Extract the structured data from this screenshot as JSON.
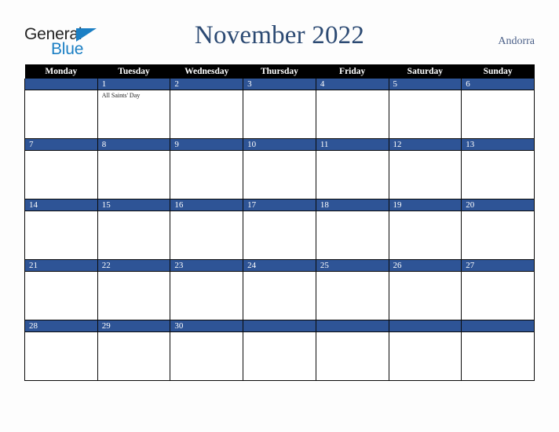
{
  "brand": {
    "line1": "General",
    "line2": "Blue",
    "triangle_color": "#1b7fc4",
    "text_color": "#242424"
  },
  "header": {
    "title": "November 2022",
    "title_color": "#2c4a73",
    "country": "Andorra",
    "country_color": "#4a5f87"
  },
  "calendar": {
    "weekday_headers": [
      "Monday",
      "Tuesday",
      "Wednesday",
      "Thursday",
      "Friday",
      "Saturday",
      "Sunday"
    ],
    "header_bg": "#000000",
    "header_text": "#ffffff",
    "daybar_bg": "#2e5496",
    "daybar_text": "#ffffff",
    "cell_bg": "#ffffff",
    "grid_line": "#0a0a0a",
    "weeks": [
      [
        {
          "day": "",
          "events": []
        },
        {
          "day": "1",
          "events": [
            "All Saints' Day"
          ]
        },
        {
          "day": "2",
          "events": []
        },
        {
          "day": "3",
          "events": []
        },
        {
          "day": "4",
          "events": []
        },
        {
          "day": "5",
          "events": []
        },
        {
          "day": "6",
          "events": []
        }
      ],
      [
        {
          "day": "7",
          "events": []
        },
        {
          "day": "8",
          "events": []
        },
        {
          "day": "9",
          "events": []
        },
        {
          "day": "10",
          "events": []
        },
        {
          "day": "11",
          "events": []
        },
        {
          "day": "12",
          "events": []
        },
        {
          "day": "13",
          "events": []
        }
      ],
      [
        {
          "day": "14",
          "events": []
        },
        {
          "day": "15",
          "events": []
        },
        {
          "day": "16",
          "events": []
        },
        {
          "day": "17",
          "events": []
        },
        {
          "day": "18",
          "events": []
        },
        {
          "day": "19",
          "events": []
        },
        {
          "day": "20",
          "events": []
        }
      ],
      [
        {
          "day": "21",
          "events": []
        },
        {
          "day": "22",
          "events": []
        },
        {
          "day": "23",
          "events": []
        },
        {
          "day": "24",
          "events": []
        },
        {
          "day": "25",
          "events": []
        },
        {
          "day": "26",
          "events": []
        },
        {
          "day": "27",
          "events": []
        }
      ],
      [
        {
          "day": "28",
          "events": []
        },
        {
          "day": "29",
          "events": []
        },
        {
          "day": "30",
          "events": []
        },
        {
          "day": "",
          "events": []
        },
        {
          "day": "",
          "events": []
        },
        {
          "day": "",
          "events": []
        },
        {
          "day": "",
          "events": []
        }
      ]
    ]
  }
}
